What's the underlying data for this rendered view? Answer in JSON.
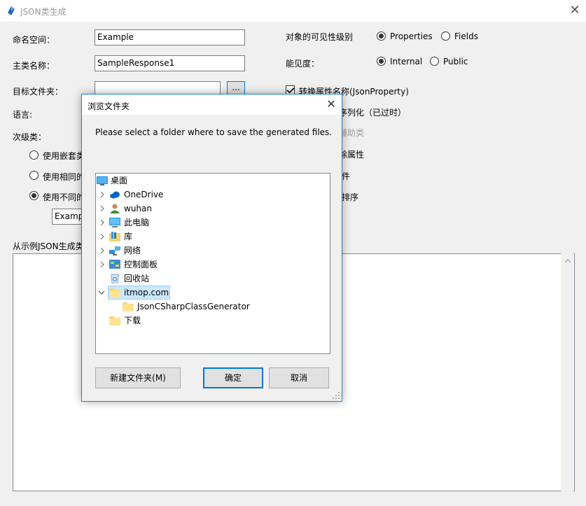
{
  "window": {
    "title": "JSON类生成",
    "close_glyph": "✕"
  },
  "form": {
    "namespace_label": "命名空间：",
    "namespace_value": "Example",
    "main_class_label": "主类名称：",
    "main_class_value": "SampleResponse1",
    "target_folder_label": "目标文件夹：",
    "target_folder_value": "",
    "browse_button": "...",
    "language_label": "语言:",
    "secondary_class_label": "次级类：",
    "secondary_options": [
      "使用嵌套类",
      "使用相同的",
      "使用不同的"
    ],
    "secondary_selected": 2,
    "secondary_namespace_value": "Examp",
    "from_json_label": "从示例JSON生成类"
  },
  "right_panel": {
    "visibility_label": "对象的可见性级别",
    "visibility_options": [
      "Properties",
      "Fields"
    ],
    "visibility_selected": 0,
    "access_label": "能见度：",
    "access_options": [
      "Internal",
      "Public"
    ],
    "access_selected": 0,
    "convert_json_property_label": "转换属性名称(JsonProperty)",
    "convert_json_property_checked": true,
    "partial_1": "序列化（已过时）",
    "partial_2": "辅助类",
    "partial_3": "除属性",
    "partial_4": "件",
    "partial_5": "排序"
  },
  "dialog": {
    "title": "浏览文件夹",
    "close_glyph": "✕",
    "description": "Please select a folder where to save the generated files.",
    "tree": [
      {
        "label": "桌面",
        "icon": "desktop-icon",
        "expandable": false,
        "level": 0
      },
      {
        "label": "OneDrive",
        "icon": "onedrive-cloud-icon",
        "expandable": true,
        "level": 1
      },
      {
        "label": "wuhan",
        "icon": "user-icon",
        "expandable": true,
        "level": 1
      },
      {
        "label": "此电脑",
        "icon": "computer-icon",
        "expandable": true,
        "level": 1
      },
      {
        "label": "库",
        "icon": "library-icon",
        "expandable": true,
        "level": 1
      },
      {
        "label": "网络",
        "icon": "network-icon",
        "expandable": true,
        "level": 1
      },
      {
        "label": "控制面板",
        "icon": "control-panel-icon",
        "expandable": true,
        "level": 1
      },
      {
        "label": "回收站",
        "icon": "recycle-bin-icon",
        "expandable": false,
        "level": 1
      },
      {
        "label": "itmop.com",
        "icon": "folder-icon",
        "expandable": true,
        "expanded": true,
        "selected": true,
        "level": 1
      },
      {
        "label": "JsonCSharpClassGenerator",
        "icon": "folder-icon",
        "expandable": false,
        "level": 2
      },
      {
        "label": "下载",
        "icon": "folder-icon",
        "expandable": false,
        "level": 1
      }
    ],
    "new_folder_button": "新建文件夹(M)",
    "ok_button": "确定",
    "cancel_button": "取消"
  },
  "colors": {
    "accent": "#0078d7",
    "selection": "#cce8ff",
    "window_bg": "#f0f0f0"
  }
}
